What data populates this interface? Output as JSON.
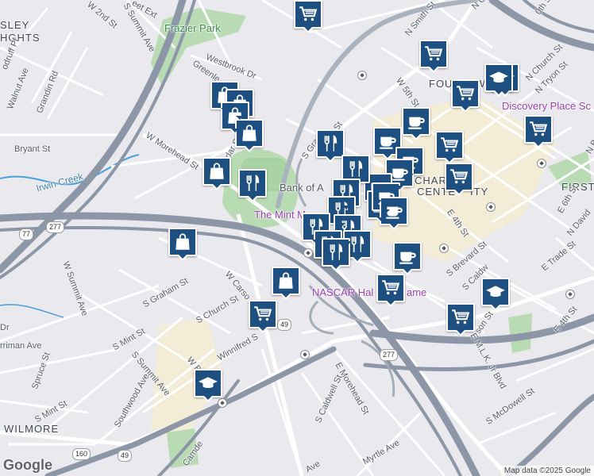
{
  "map": {
    "attribution": "Map data ©2025 Google",
    "logo": "Google",
    "colors": {
      "land": "#e9e9ee",
      "downtown": "#f3ecd6",
      "park": "#b8dbb3",
      "highway": "#8c96a6",
      "arterial": "#ffffff",
      "water": "#4aa0d8",
      "marker_bg": "#1d4f80",
      "poi_purple": "#9b3fb3",
      "poi_green": "#3c8a4d"
    }
  },
  "labels": {
    "frazier_park": "Frazier Park",
    "sley_heights_1": "SLEY",
    "sley_heights_2": "HGHTS",
    "bank_of_america": "Bank of A",
    "the_mint": "The Mint M",
    "nascar_hall": "NASCAR Hal",
    "nascar_hall_2": "ame",
    "discovery_place": "Discovery Place Sc",
    "charlotte_center_1": "CHAR",
    "charlotte_center_2": "E",
    "charlotte_center_3": "CENTE",
    "charlotte_center_4": "ITY",
    "fourth_ward": "FOU",
    "fourth_ward_2": "W",
    "first_ward": "FIRST",
    "wilmore": "WILMORE",
    "irwin_creek": "Irwin Creek",
    "w_2nd_st": "W 2nd St",
    "s_summit_ave_top": "S Summit Ave",
    "et_ext": "eet Ext",
    "westbrook_dr": "Westbrook Dr",
    "greenleaf": "Greenle",
    "odruff_pl": "odruff Pl",
    "walnut_ave": "Walnut Ave",
    "grandin_rd": "Grandin Rd",
    "bryant_st": "Bryant St",
    "w_morehead_st": "W Morehead St",
    "s_cedar_st": "dar St",
    "s_graham_st_top": "S Gra",
    "s_graham_st_top2": "St",
    "n_smith_st": "N Smith St",
    "w_5th_st": "W 5th St",
    "n_church_st": "N Church St",
    "n_tryon_st": "N Tryon St",
    "n_gr": "N Gr",
    "oth_st": "0th St",
    "e_6th_st": "E 6th St",
    "n_davidson": "N David",
    "n_br": "N Br",
    "e_trade_st": "E Trade St",
    "e_4th_st_right": "E 4th St",
    "e_4th_st": "E 4th St",
    "s_brevard_st": "S Brevard St",
    "s_caldwell": "S Caldw",
    "s_d_son": "S D",
    "son_st": "son St",
    "e_mlk": "E M.L.K. Jr Blvd",
    "s_mcdowell": "S McDowell St",
    "e_morehead_st": "E Morehead St",
    "s_caldwell_st": "S Caldwell St",
    "myrtle_ave": "Myrtle Ave",
    "ave_bottom": "Ave",
    "w_summit_ave": "W Summit Ave",
    "s_graham_st": "S Graham St",
    "w_carson": "W Carso",
    "s_church_st": "S Church St",
    "s_mint_st": "S Mint St",
    "winnifred_st": "Winnifred S",
    "w_bl": "W Bl",
    "s_summit_ave_2": "S Summit Ave",
    "southwood_ave": "Southwood Ave",
    "spruce_st": "Spruce St",
    "s_mint_st_2": "S Mint St",
    "rriman_ave": "rriman Ave",
    "dr": "Dr",
    "camden": "Camde",
    "shield_277_a": "277",
    "shield_77": "77",
    "shield_49_a": "49",
    "shield_277_b": "277",
    "shield_160": "160",
    "shield_49_b": "49"
  },
  "markers": [
    {
      "icon": "cart-icon",
      "kind": "grocery"
    },
    {
      "icon": "cart-icon",
      "kind": "grocery"
    },
    {
      "icon": "graduation-cap-icon",
      "kind": "school"
    },
    {
      "icon": "cart-icon",
      "kind": "grocery"
    },
    {
      "icon": "cup-icon",
      "kind": "cafe"
    },
    {
      "icon": "cart-icon",
      "kind": "grocery"
    },
    {
      "icon": "cup-icon",
      "kind": "cafe"
    },
    {
      "icon": "cup-icon",
      "kind": "cafe"
    },
    {
      "icon": "cart-icon",
      "kind": "grocery"
    },
    {
      "icon": "cart-icon",
      "kind": "grocery"
    },
    {
      "icon": "cup-icon",
      "kind": "cafe"
    },
    {
      "icon": "cup-icon",
      "kind": "cafe"
    },
    {
      "icon": "cup-icon",
      "kind": "cafe"
    },
    {
      "icon": "fork-knife-icon",
      "kind": "restaurant"
    },
    {
      "icon": "fork-knife-icon",
      "kind": "restaurant"
    },
    {
      "icon": "fork-knife-icon",
      "kind": "restaurant"
    },
    {
      "icon": "fork-knife-icon",
      "kind": "restaurant"
    },
    {
      "icon": "fork-knife-icon",
      "kind": "restaurant"
    },
    {
      "icon": "fork-knife-icon",
      "kind": "restaurant"
    },
    {
      "icon": "fork-knife-icon",
      "kind": "restaurant"
    },
    {
      "icon": "fork-knife-icon",
      "kind": "restaurant"
    },
    {
      "icon": "fork-knife-icon",
      "kind": "restaurant"
    },
    {
      "icon": "fork-knife-icon",
      "kind": "restaurant"
    },
    {
      "icon": "cup-icon",
      "kind": "cafe"
    },
    {
      "icon": "cup-icon",
      "kind": "cafe"
    },
    {
      "icon": "cup-icon",
      "kind": "cafe"
    },
    {
      "icon": "shopping-bag-icon",
      "kind": "shopping"
    },
    {
      "icon": "shopping-bag-icon",
      "kind": "shopping"
    },
    {
      "icon": "shopping-bag-icon",
      "kind": "shopping"
    },
    {
      "icon": "shopping-bag-icon",
      "kind": "shopping"
    },
    {
      "icon": "shopping-bag-icon",
      "kind": "shopping"
    },
    {
      "icon": "shopping-bag-icon",
      "kind": "shopping"
    },
    {
      "icon": "shopping-bag-icon",
      "kind": "shopping"
    },
    {
      "icon": "cart-icon",
      "kind": "grocery"
    },
    {
      "icon": "graduation-cap-icon",
      "kind": "school"
    },
    {
      "icon": "graduation-cap-icon",
      "kind": "school"
    },
    {
      "icon": "cart-icon",
      "kind": "grocery"
    },
    {
      "icon": "cart-icon",
      "kind": "grocery"
    },
    {
      "icon": "graduation-cap-icon",
      "kind": "school"
    }
  ]
}
